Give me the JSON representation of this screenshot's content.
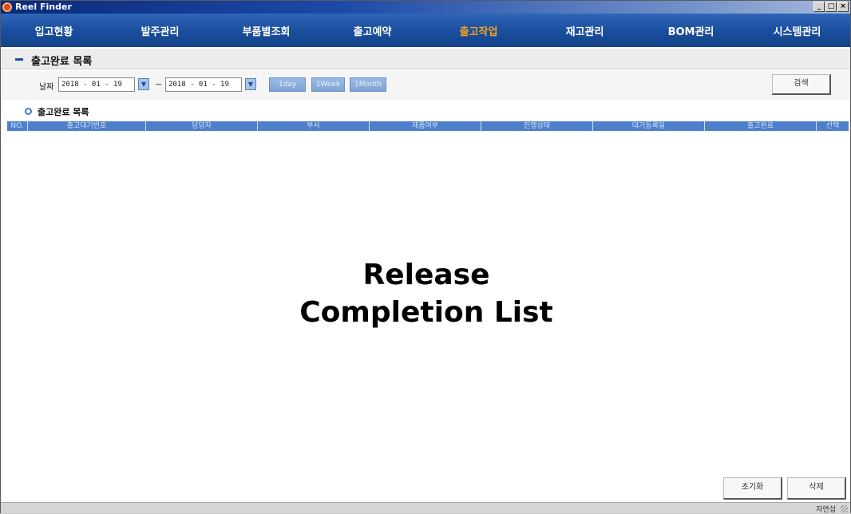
{
  "window": {
    "title": "Reel Finder",
    "controls": [
      "_",
      "□",
      "×"
    ]
  },
  "menu": {
    "items": [
      "입고현황",
      "발주관리",
      "부품별조회",
      "출고예약",
      "출고작업",
      "재고관리",
      "BOM관리",
      "시스템관리"
    ],
    "active_index": 4,
    "active_color": "#f7a21c"
  },
  "section": {
    "title": "출고완료 목록"
  },
  "filter": {
    "date_label": "날짜",
    "date_from": "2018 - 01 - 19",
    "date_sep": "~",
    "date_to": "2018 - 01 - 19",
    "range_buttons": [
      "1day",
      "1Week",
      "1Month"
    ],
    "search_label": "검색"
  },
  "list": {
    "title": "출고완료 목록",
    "columns": [
      "NO.",
      "출고대기번호",
      "담당자",
      "부서",
      "제품여부",
      "진행상태",
      "대기등록일",
      "출고완료",
      "선택"
    ]
  },
  "overlay": {
    "line1": "Release",
    "line2": "Completion List"
  },
  "actions": {
    "reset_label": "초기화",
    "delete_label": "삭제"
  },
  "status": {
    "text": "자연섭"
  },
  "icons": {
    "app": "reel-finder-logo-icon",
    "section": "minus-icon",
    "list": "circle-icon",
    "dropdown": "chevron-down-icon",
    "grip": "resize-grip-icon"
  }
}
